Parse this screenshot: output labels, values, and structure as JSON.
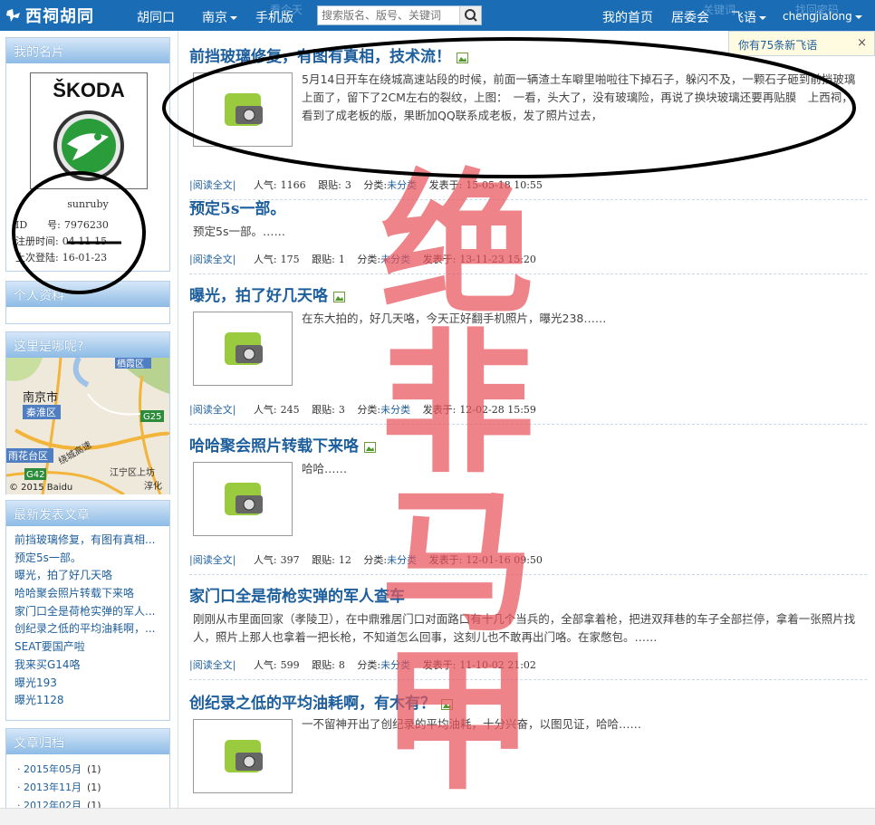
{
  "topbar": {
    "logo_text": "西祠胡同",
    "nav": {
      "hutong": "胡同口",
      "city": "南京",
      "mobile": "手机版",
      "home": "我的首页",
      "committee": "居委会",
      "feiyu": "飞语",
      "username": "chengjialong"
    },
    "search_placeholder": "搜索版名、版号、关键词",
    "faint_top": {
      "left": "看今天",
      "right1": "关键词",
      "right2": "找回密码"
    }
  },
  "notice": {
    "text": "你有75条新飞语",
    "close": "×"
  },
  "sidebar": {
    "card": {
      "title": "我的名片",
      "brand_text": "ŠKODA",
      "username": "sunruby",
      "id_label": "ID　　号:",
      "id_value": "7976230",
      "reg_label": "注册时间:",
      "reg_value": "04-11-15",
      "last_label": "上次登陆:",
      "last_value": "16-01-23"
    },
    "profile": {
      "title": "个人资料"
    },
    "where": {
      "title": "这里是哪呢?",
      "map": {
        "city": "南京市",
        "district1": "秦淮区",
        "district2": "雨花台区",
        "district3": "栖霞区",
        "district4": "江宁区上坊",
        "district5": "淳化",
        "road1": "G25",
        "road2": "G42",
        "road3": "绕城高速",
        "copyright": "© 2015 Baidu"
      }
    },
    "newposts": {
      "title": "最新发表文章",
      "items": [
        "前挡玻璃修复，有图有真相...",
        "预定5s一部。",
        "曝光，拍了好几天咯",
        "哈哈聚会照片转载下来咯",
        "家门口全是荷枪实弹的军人...",
        "创纪录之低的平均油耗啊，...",
        "SEAT要国产啦",
        "我来买G14咯",
        "曝光193",
        "曝光1128"
      ]
    },
    "archive": {
      "title": "文章归档",
      "items": [
        {
          "month": "2015年05月",
          "count": "(1)"
        },
        {
          "month": "2013年11月",
          "count": "(1)"
        },
        {
          "month": "2012年02月",
          "count": "(1)"
        }
      ]
    }
  },
  "posts": [
    {
      "title": "前挡玻璃修复，有图有真相，技术流！",
      "excerpt": "5月14日开车在绕城高速站段的时候，前面一辆渣土车噼里啪啦往下掉石子，躲闪不及，一颗石子砸到前挡玻璃上面了，留下了2CM左右的裂纹，上图：　一看，头大了，没有玻璃险，再说了换块玻璃还要再贴膜　上西祠，看到了成老板的版，果断加QQ联系成老板，发了照片过去，",
      "readmore": "阅读全文",
      "popularity_label": "人气:",
      "popularity": "1166",
      "replies_label": "跟贴:",
      "replies": "3",
      "category_label": "分类:",
      "category": "未分类",
      "posted_label": "发表于:",
      "posted": "15-05-18 10:55"
    },
    {
      "title": "预定5s一部。",
      "excerpt": "预定5s一部。……",
      "readmore": "阅读全文",
      "popularity_label": "人气:",
      "popularity": "175",
      "replies_label": "跟贴:",
      "replies": "1",
      "category_label": "分类:",
      "category": "未分类",
      "posted_label": "发表于:",
      "posted": "13-11-23 15:20"
    },
    {
      "title": "曝光，拍了好几天咯",
      "excerpt": "在东大拍的，好几天咯，今天正好翻手机照片，曝光238……",
      "readmore": "阅读全文",
      "popularity_label": "人气:",
      "popularity": "245",
      "replies_label": "跟贴:",
      "replies": "3",
      "category_label": "分类:",
      "category": "未分类",
      "posted_label": "发表于:",
      "posted": "12-02-28 15:59"
    },
    {
      "title": "哈哈聚会照片转载下来咯",
      "excerpt": "哈哈……",
      "readmore": "阅读全文",
      "popularity_label": "人气:",
      "popularity": "397",
      "replies_label": "跟贴:",
      "replies": "12",
      "category_label": "分类:",
      "category": "未分类",
      "posted_label": "发表于:",
      "posted": "12-01-16 09:50"
    },
    {
      "title": "家门口全是荷枪实弹的军人查车",
      "excerpt": "刚刚从市里面回家（孝陵卫），在中鼎雅居门口对面路口有十几个当兵的，全部拿着枪，把进双拜巷的车子全部拦停，拿着一张照片找人，照片上那人也拿着一把长枪，不知道怎么回事，这刻儿也不敢再出门咯。在家憋包。……",
      "readmore": "阅读全文",
      "popularity_label": "人气:",
      "popularity": "599",
      "replies_label": "跟贴:",
      "replies": "8",
      "category_label": "分类:",
      "category": "未分类",
      "posted_label": "发表于:",
      "posted": "11-10-02 21:02"
    },
    {
      "title": "创纪录之低的平均油耗啊，有木有？",
      "excerpt": "一不留神开出了创纪录的平均油耗，十分兴奋，以图见证，哈哈……"
    }
  ],
  "watermark": {
    "chars": [
      "绝",
      "非",
      "马",
      "甲"
    ],
    "color": "#e8545c"
  },
  "colors": {
    "topbar": "#1a6db5",
    "link": "#1d5e9c",
    "sidebar_head": "#8dbbe6"
  }
}
